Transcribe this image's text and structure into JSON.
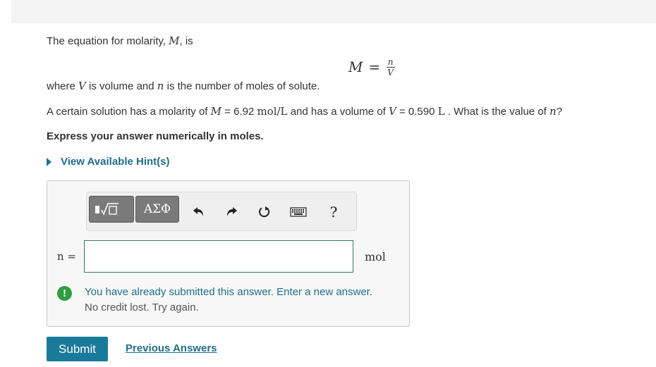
{
  "intro": {
    "text": "The equation for molarity, ",
    "var": "M",
    "suffix": ", is"
  },
  "equation": {
    "lhs": "M",
    "equals": "=",
    "numerator": "n",
    "denominator": "V"
  },
  "where": {
    "t1": "where ",
    "v": "V",
    "t2": " is volume and ",
    "n": "n",
    "t3": " is the number of moles of solute."
  },
  "question": {
    "t1": "A certain solution has a molarity of ",
    "mvar": "M",
    "t2": " = 6.92 ",
    "unit1": "mol/L",
    "t3": " and has a volume of ",
    "vvar": "V",
    "t4": " = 0.590 ",
    "unit2": "L",
    "t5": " . What is the value of ",
    "nvar": "n",
    "t6": "?"
  },
  "instruction": "Express your answer numerically in moles.",
  "hint_label": "View Available Hint(s)",
  "toolbar": {
    "templates_label": "√□",
    "symbols_label": "ΑΣΦ",
    "undo_icon": "undo-icon",
    "redo_icon": "redo-icon",
    "reset_icon": "reset-icon",
    "keyboard_icon": "keyboard-icon",
    "help_label": "?"
  },
  "answer": {
    "label": "n =",
    "value": "",
    "placeholder": "",
    "unit": "mol"
  },
  "feedback": {
    "line1": "You have already submitted this answer. Enter a new answer.",
    "line2": "No credit lost. Try again."
  },
  "submit_label": "Submit",
  "previous_answers_label": "Previous Answers",
  "colors": {
    "accent": "#1d6f8c",
    "button": "#1a7a9c",
    "warning": "#2e9e3e"
  }
}
